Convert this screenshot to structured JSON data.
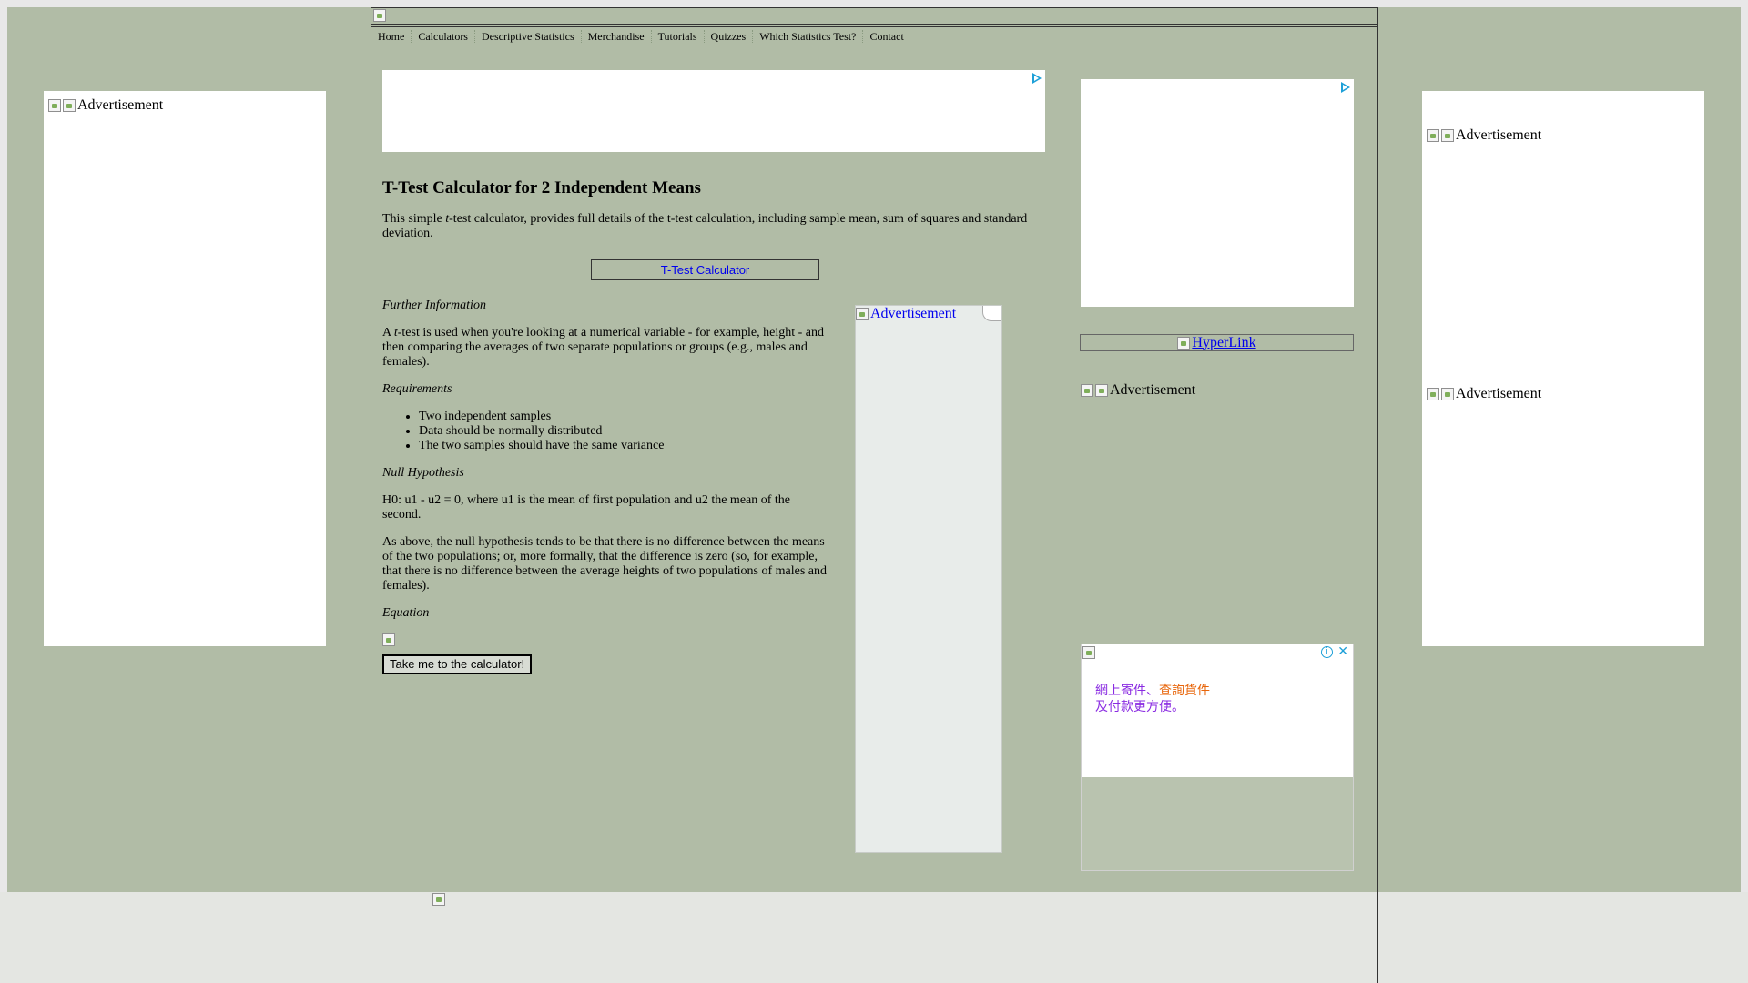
{
  "nav": {
    "items": [
      "Home",
      "Calculators",
      "Descriptive Statistics",
      "Merchandise",
      "Tutorials",
      "Quizzes",
      "Which Statistics Test?",
      "Contact"
    ]
  },
  "ads": {
    "left_label": "Advertisement",
    "right_top_label": "Advertisement",
    "right_bottom_label": "Advertisement",
    "sidebar_label": "Advertisement",
    "mid_label": "Advertisement",
    "hyperlink": "HyperLink",
    "zh_line1": "網上寄件、查詢貨件",
    "zh_line2": "及付款更方便。"
  },
  "main": {
    "title": "T-Test Calculator for 2 Independent Means",
    "intro_a": "This simple ",
    "intro_t": "t",
    "intro_b": "-test calculator, provides full details of the t-test calculation, including sample mean, sum of squares and standard deviation.",
    "calc_button": "T-Test Calculator",
    "further_title": "Further Information",
    "further_a": "A ",
    "further_t": "t",
    "further_b": "-test is used when you're looking at a numerical variable - for example, height - and then comparing the averages of two separate populations or groups (e.g., males and females).",
    "requirements_title": "Requirements",
    "requirements": [
      "Two independent samples",
      "Data should be normally distributed",
      "The two samples should have the same variance"
    ],
    "null_title": "Null Hypothesis",
    "null_text": "H0: u1 - u2 = 0, where u1 is the mean of first population and u2 the mean of the second.",
    "null_explain": "As above, the null hypothesis tends to be that there is no difference between the means of the two populations; or, more formally, that the difference is zero (so, for example, that there is no difference between the average heights of two populations of males and females).",
    "equation_title": "Equation",
    "take_button": "Take me to the calculator!"
  }
}
